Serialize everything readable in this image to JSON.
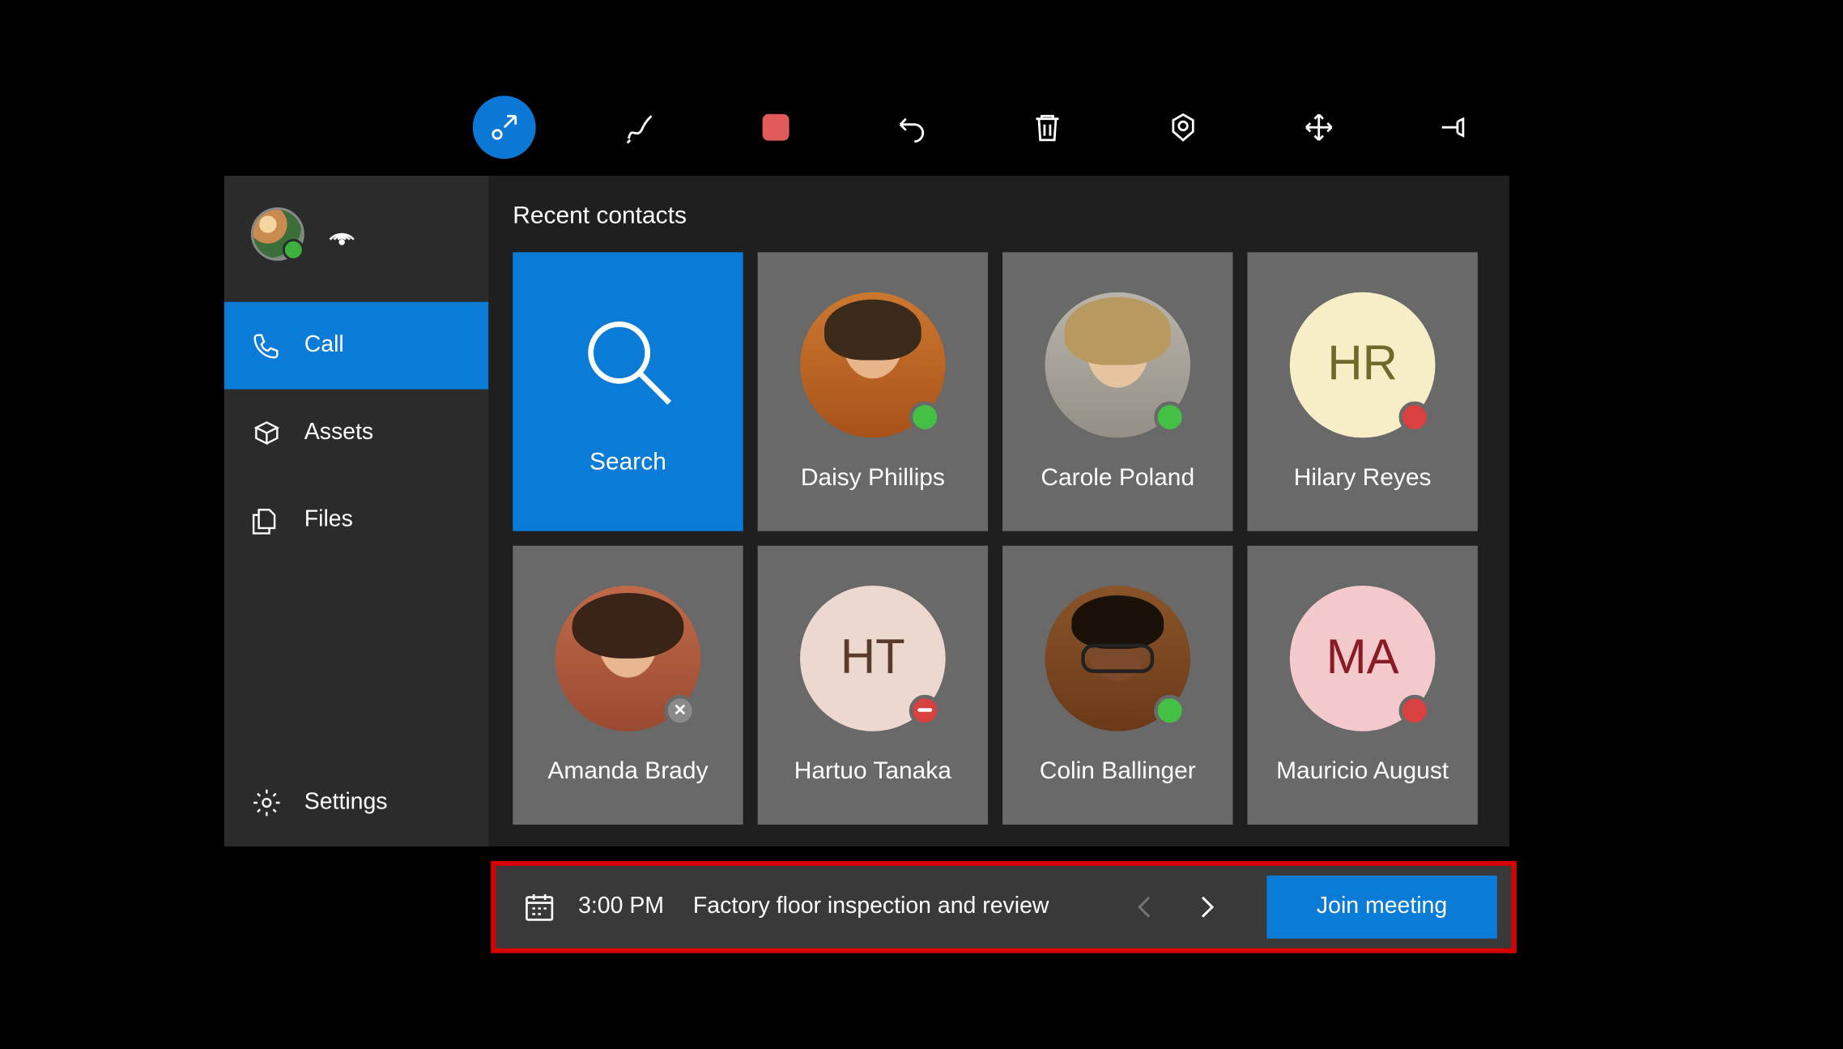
{
  "toolbar": {
    "items": [
      {
        "id": "collapse",
        "active": true
      },
      {
        "id": "ink"
      },
      {
        "id": "shape"
      },
      {
        "id": "undo"
      },
      {
        "id": "delete"
      },
      {
        "id": "camera"
      },
      {
        "id": "move"
      },
      {
        "id": "pin"
      }
    ]
  },
  "sidebar": {
    "nav": [
      {
        "id": "call",
        "label": "Call",
        "active": true
      },
      {
        "id": "assets",
        "label": "Assets"
      },
      {
        "id": "files",
        "label": "Files"
      }
    ],
    "settings_label": "Settings"
  },
  "content": {
    "section_title": "Recent contacts",
    "search_label": "Search",
    "contacts": [
      {
        "name": "Daisy Phillips",
        "kind": "photo",
        "face": "daisy",
        "status": "available"
      },
      {
        "name": "Carole Poland",
        "kind": "photo",
        "face": "carole",
        "status": "available"
      },
      {
        "name": "Hilary Reyes",
        "kind": "initials",
        "initials": "HR",
        "bg": "#f7eec7",
        "fg": "#6e6a2a",
        "status": "busy"
      },
      {
        "name": "Amanda Brady",
        "kind": "photo",
        "face": "amanda",
        "status": "offline"
      },
      {
        "name": "Hartuo Tanaka",
        "kind": "initials",
        "initials": "HT",
        "bg": "#ecd8cf",
        "fg": "#5a3a2a",
        "status": "dnd"
      },
      {
        "name": "Colin Ballinger",
        "kind": "photo",
        "face": "colin",
        "status": "available"
      },
      {
        "name": "Mauricio August",
        "kind": "initials",
        "initials": "MA",
        "bg": "#f3c9cc",
        "fg": "#8a1a24",
        "status": "busy"
      }
    ]
  },
  "meeting": {
    "time": "3:00 PM",
    "title": "Factory floor inspection and review",
    "join_label": "Join meeting"
  }
}
